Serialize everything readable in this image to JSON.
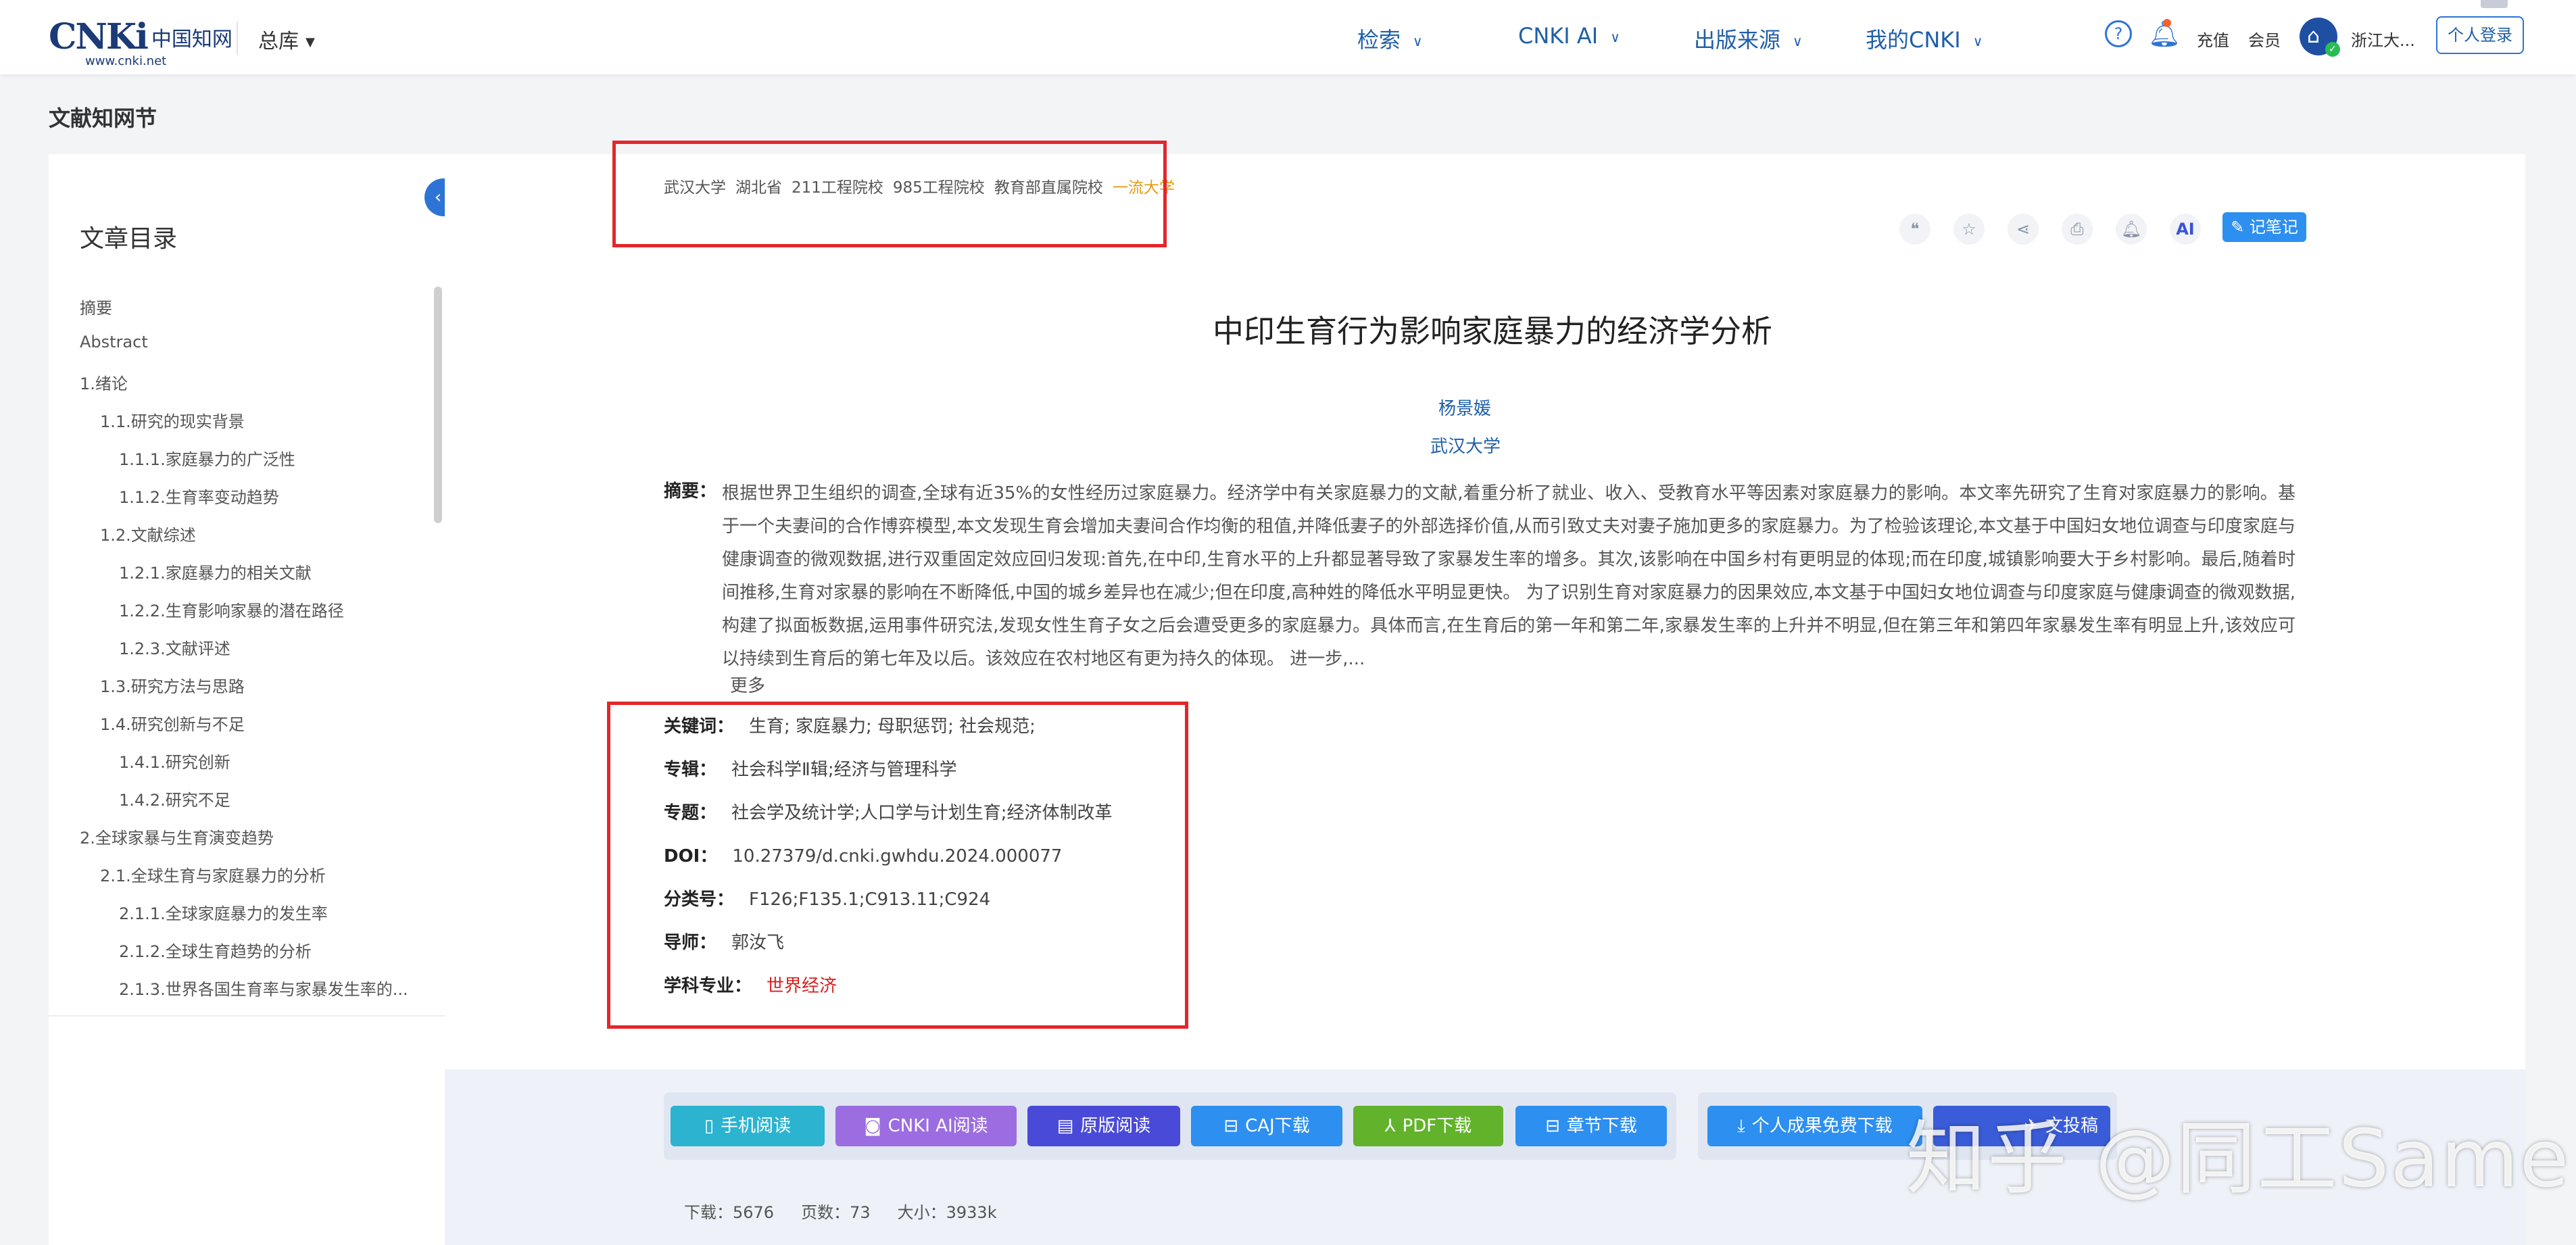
{
  "header": {
    "logo_text": "CNKi",
    "logo_cn": "中国知网",
    "logo_url": "www.cnki.net",
    "library": "总库",
    "nav": [
      {
        "label": "检索"
      },
      {
        "label": "CNKI AI"
      },
      {
        "label": "出版来源"
      },
      {
        "label": "我的CNKI"
      }
    ],
    "recharge": "充值",
    "member": "会员",
    "institution": "浙江大...",
    "login": "个人登录"
  },
  "section_title": "文献知网节",
  "toc": {
    "title": "文章目录",
    "items": [
      {
        "label": "摘要",
        "level": 0
      },
      {
        "label": "Abstract",
        "level": 0
      },
      {
        "label": "1.绪论",
        "level": 0
      },
      {
        "label": "1.1.研究的现实背景",
        "level": 1
      },
      {
        "label": "1.1.1.家庭暴力的广泛性",
        "level": 2
      },
      {
        "label": "1.1.2.生育率变动趋势",
        "level": 2
      },
      {
        "label": "1.2.文献综述",
        "level": 1
      },
      {
        "label": "1.2.1.家庭暴力的相关文献",
        "level": 2
      },
      {
        "label": "1.2.2.生育影响家暴的潜在路径",
        "level": 2
      },
      {
        "label": "1.2.3.文献评述",
        "level": 2
      },
      {
        "label": "1.3.研究方法与思路",
        "level": 1
      },
      {
        "label": "1.4.研究创新与不足",
        "level": 1
      },
      {
        "label": "1.4.1.研究创新",
        "level": 2
      },
      {
        "label": "1.4.2.研究不足",
        "level": 2
      },
      {
        "label": "2.全球家暴与生育演变趋势",
        "level": 0
      },
      {
        "label": "2.1.全球生育与家庭暴力的分析",
        "level": 1
      },
      {
        "label": "2.1.1.全球家庭暴力的发生率",
        "level": 2
      },
      {
        "label": "2.1.2.全球生育趋势的分析",
        "level": 2
      },
      {
        "label": "2.1.3.世界各国生育率与家暴发生率的...",
        "level": 2
      }
    ]
  },
  "affiliation": {
    "tags": [
      "武汉大学",
      "湖北省",
      "211工程院校",
      "985工程院校",
      "教育部直属院校"
    ],
    "highlight": "一流大学"
  },
  "actions": {
    "icons": [
      "quote-icon",
      "star-icon",
      "share-icon",
      "print-icon",
      "bell-icon",
      "ai-icon"
    ],
    "ai_label": "AI",
    "note": "记笔记"
  },
  "paper": {
    "title": "中印生育行为影响家庭暴力的经济学分析",
    "author": "杨景媛",
    "institution": "武汉大学",
    "abstract_label": "摘要：",
    "abstract": "根据世界卫生组织的调查,全球有近35%的女性经历过家庭暴力。经济学中有关家庭暴力的文献,着重分析了就业、收入、受教育水平等因素对家庭暴力的影响。本文率先研究了生育对家庭暴力的影响。基于一个夫妻间的合作博弈模型,本文发现生育会增加夫妻间合作均衡的租值,并降低妻子的外部选择价值,从而引致丈夫对妻子施加更多的家庭暴力。为了检验该理论,本文基于中国妇女地位调查与印度家庭与健康调查的微观数据,进行双重固定效应回归发现:首先,在中印,生育水平的上升都显著导致了家暴发生率的增多。其次,该影响在中国乡村有更明显的体现;而在印度,城镇影响要大于乡村影响。最后,随着时间推移,生育对家暴的影响在不断降低,中国的城乡差异也在减少;但在印度,高种姓的降低水平明显更快。 为了识别生育对家庭暴力的因果效应,本文基于中国妇女地位调查与印度家庭与健康调查的微观数据,构建了拟面板数据,运用事件研究法,发现女性生育子女之后会遭受更多的家庭暴力。具体而言,在生育后的第一年和第二年,家暴发生率的上升并不明显,但在第三年和第四年家暴发生率有明显上升,该效应可以持续到生育后的第七年及以后。该效应在农村地区有更为持久的体现。 进一步,...",
    "more": "更多",
    "meta": [
      {
        "key": "关键词：",
        "value": "生育;  家庭暴力;  母职惩罚;  社会规范;"
      },
      {
        "key": "专辑：",
        "value": "社会科学Ⅱ辑;经济与管理科学"
      },
      {
        "key": "专题：",
        "value": "社会学及统计学;人口学与计划生育;经济体制改革"
      },
      {
        "key": "DOI：",
        "value": "10.27379/d.cnki.gwhdu.2024.000077"
      },
      {
        "key": "分类号：",
        "value": "F126;F135.1;C913.11;C924"
      },
      {
        "key": "导师：",
        "value": "郭汝飞"
      },
      {
        "key": "学科专业：",
        "value": "世界经济"
      }
    ]
  },
  "buttons": [
    {
      "label": "手机阅读",
      "icon": "phone-icon",
      "color": "#2bb3d0"
    },
    {
      "label": "CNKI AI阅读",
      "icon": "ai-icon",
      "color": "#9b6de0"
    },
    {
      "label": "原版阅读",
      "icon": "book-icon",
      "color": "#4a4ad8"
    },
    {
      "label": "CAJ下载",
      "icon": "book-open-icon",
      "color": "#2d8ff0"
    },
    {
      "label": "PDF下载",
      "icon": "pdf-icon",
      "color": "#62b32b"
    },
    {
      "label": "章节下载",
      "icon": "book-open-icon",
      "color": "#2d8ff0"
    },
    {
      "label": "个人成果免费下载",
      "icon": "download-icon",
      "color": "#2d8ff0"
    },
    {
      "label": "文投稿",
      "icon": "submit-icon",
      "color": "#3a5cd8"
    }
  ],
  "stats": {
    "downloads": "下载：5676",
    "pages": "页数：73",
    "size": "大小：3933k"
  },
  "watermark": "知乎 @同工Same"
}
